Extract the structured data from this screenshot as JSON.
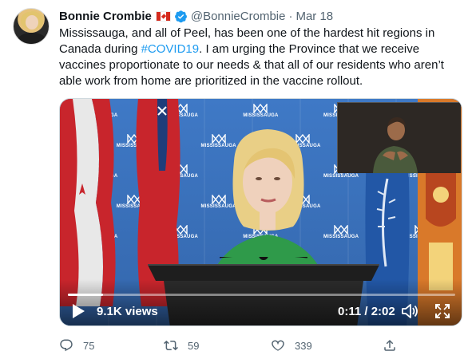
{
  "tweet": {
    "author_name": "Bonnie Crombie",
    "handle": "@BonnieCrombie",
    "separator": "·",
    "date": "Mar 18",
    "text_before": "Mississauga, and all of Peel, has been one of the hardest hit regions in Canada during ",
    "hashtag": "#COVID19",
    "text_after": ". I am urging the Province that we receive vaccines proportionate to our needs & that all of our residents who aren’t able work from home are prioritized in the vaccine rollout."
  },
  "media": {
    "backdrop_text": "MISSISSAUGA",
    "views": "9.1K views",
    "time": "0:11 / 2:02",
    "progress_fraction": 0.09,
    "icons": [
      "play-icon",
      "volume-icon",
      "fullscreen-icon"
    ]
  },
  "actions": {
    "replies": "75",
    "retweets": "59",
    "likes": "339"
  },
  "colors": {
    "accent": "#1d9bf0",
    "muted": "#536471",
    "backdrop_blue": "#3a6fb5"
  }
}
